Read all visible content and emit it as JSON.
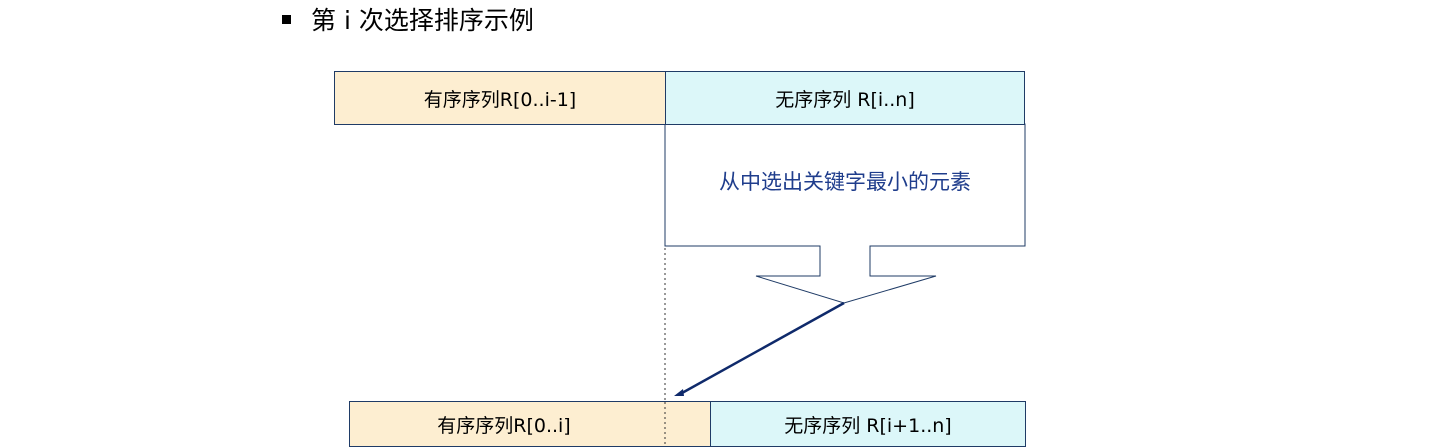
{
  "heading": {
    "text": "第 i 次选择排序示例"
  },
  "top_row": {
    "sorted_label": "有序序列R[0..i-1]",
    "unsorted_label": "无序序列 R[i..n]"
  },
  "callout": {
    "text": "从中选出关键字最小的元素"
  },
  "bottom_row": {
    "sorted_label": "有序序列R[0..i]",
    "unsorted_label": "无序序列 R[i+1..n]"
  },
  "colors": {
    "sorted_fill": "#fdeed1",
    "unsorted_fill": "#dcf7f9",
    "outline": "#1f3b66",
    "callout_text": "#1f3d8c",
    "arrow": "#0f2a6b"
  }
}
